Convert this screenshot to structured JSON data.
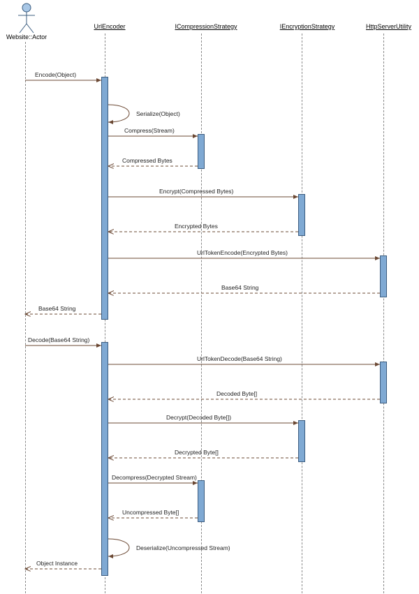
{
  "diagram_type": "sequence",
  "actor": {
    "name": "Website::Actor"
  },
  "participants": [
    {
      "id": "urlencoder",
      "label": "UrlEncoder"
    },
    {
      "id": "compression",
      "label": "ICompressionStrategy"
    },
    {
      "id": "encryption",
      "label": "IEncryptionStrategy"
    },
    {
      "id": "httpserver",
      "label": "HttpServerUtility"
    }
  ],
  "messages": {
    "encode_call": "Encode(Object)",
    "serialize": "Serialize(Object)",
    "compress": "Compress(Stream)",
    "compressed_return": "Compressed Bytes",
    "encrypt": "Encrypt(Compressed Bytes)",
    "encrypted_return": "Encrypted Bytes",
    "urltokenencode": "UrlTokenEncode(Encrypted Bytes)",
    "base64_return": "Base64 String",
    "base64_to_actor": "Base64 String",
    "decode_call": "Decode(Base64 String)",
    "urltokendecode": "UrlTokenDecode(Base64 String)",
    "decoded_return": "Decoded Byte[]",
    "decrypt": "Decrypt(Decoded Byte[])",
    "decrypted_return": "Decrypted Byte[]",
    "decompress": "Decompress(Decrypted Stream)",
    "uncompressed_return": "Uncompressed Byte[]",
    "deserialize": "Deserialize(Uncompressed Stream)",
    "object_return": "Object Instance"
  }
}
